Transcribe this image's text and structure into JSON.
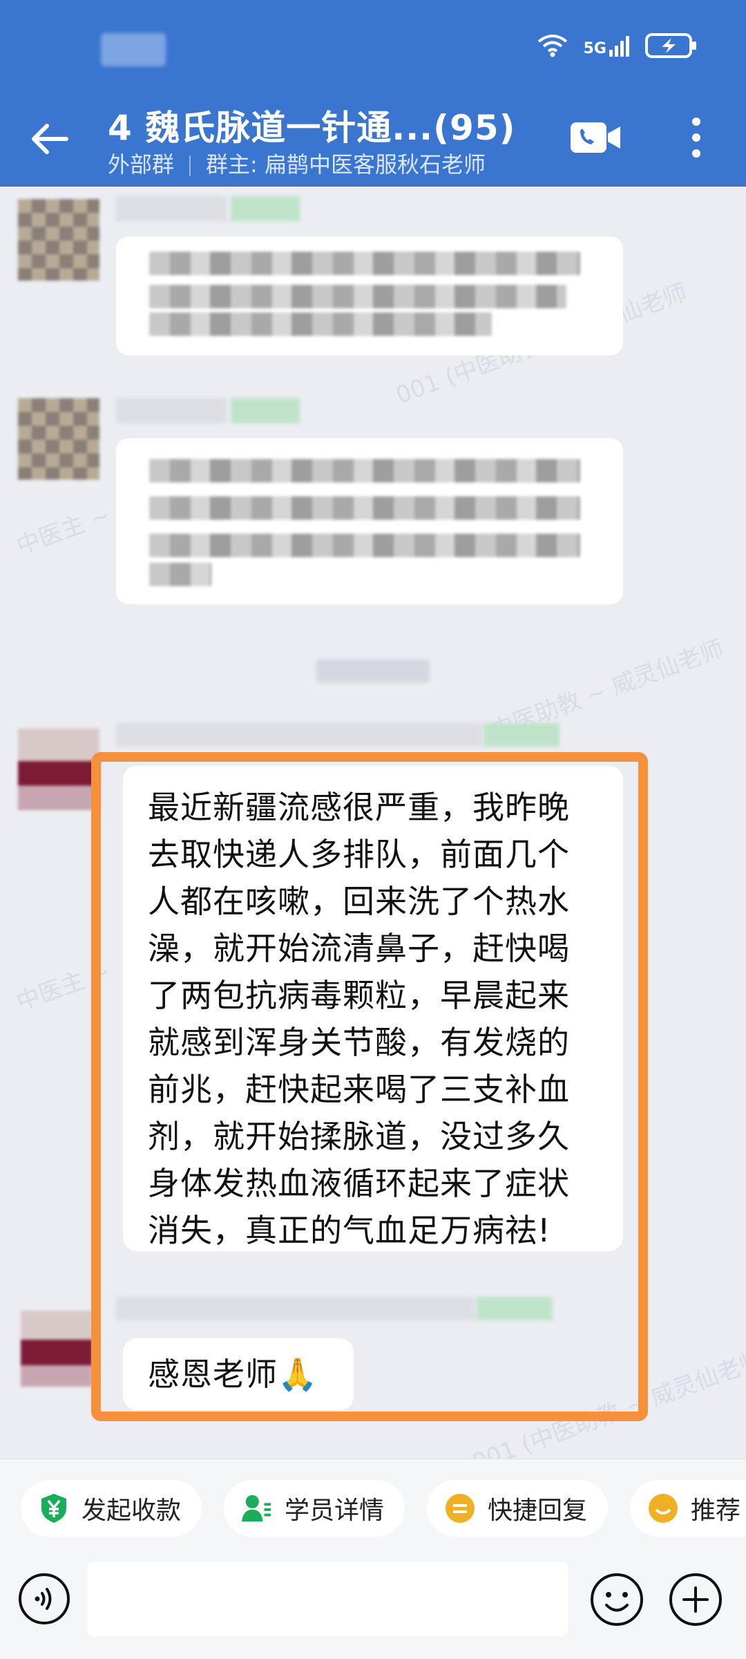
{
  "header": {
    "network": "5G",
    "title": "4 魏氏脉道一针通...(95)",
    "tag": "外部群",
    "owner": "群主: 扁鹊中医客服秋石老师"
  },
  "messages": {
    "highlighted_text": "最近新疆流感很严重，我昨晚去取快递人多排队，前面几个人都在咳嗽，回来洗了个热水澡，就开始流清鼻子，赶快喝了两包抗病毒颗粒，早晨起来就感到浑身关节酸，有发烧的前兆，赶快起来喝了三支补血剂，就开始揉脉道，没过多久身体发热血液循环起来了症状消失，真正的气血足万病祛!",
    "thanks_text": "感恩老师🙏"
  },
  "quick_actions": [
    {
      "label": "发起收款",
      "icon": "yen-icon",
      "color": "#1aad5c"
    },
    {
      "label": "学员详情",
      "icon": "student-icon",
      "color": "#1aad5c"
    },
    {
      "label": "快捷回复",
      "icon": "quick-reply-icon",
      "color": "#f0b024"
    },
    {
      "label": "推荐",
      "icon": "recommend-icon",
      "color": "#f0b024"
    }
  ],
  "colors": {
    "header": "#3a76cf",
    "highlight": "#f5913c"
  }
}
